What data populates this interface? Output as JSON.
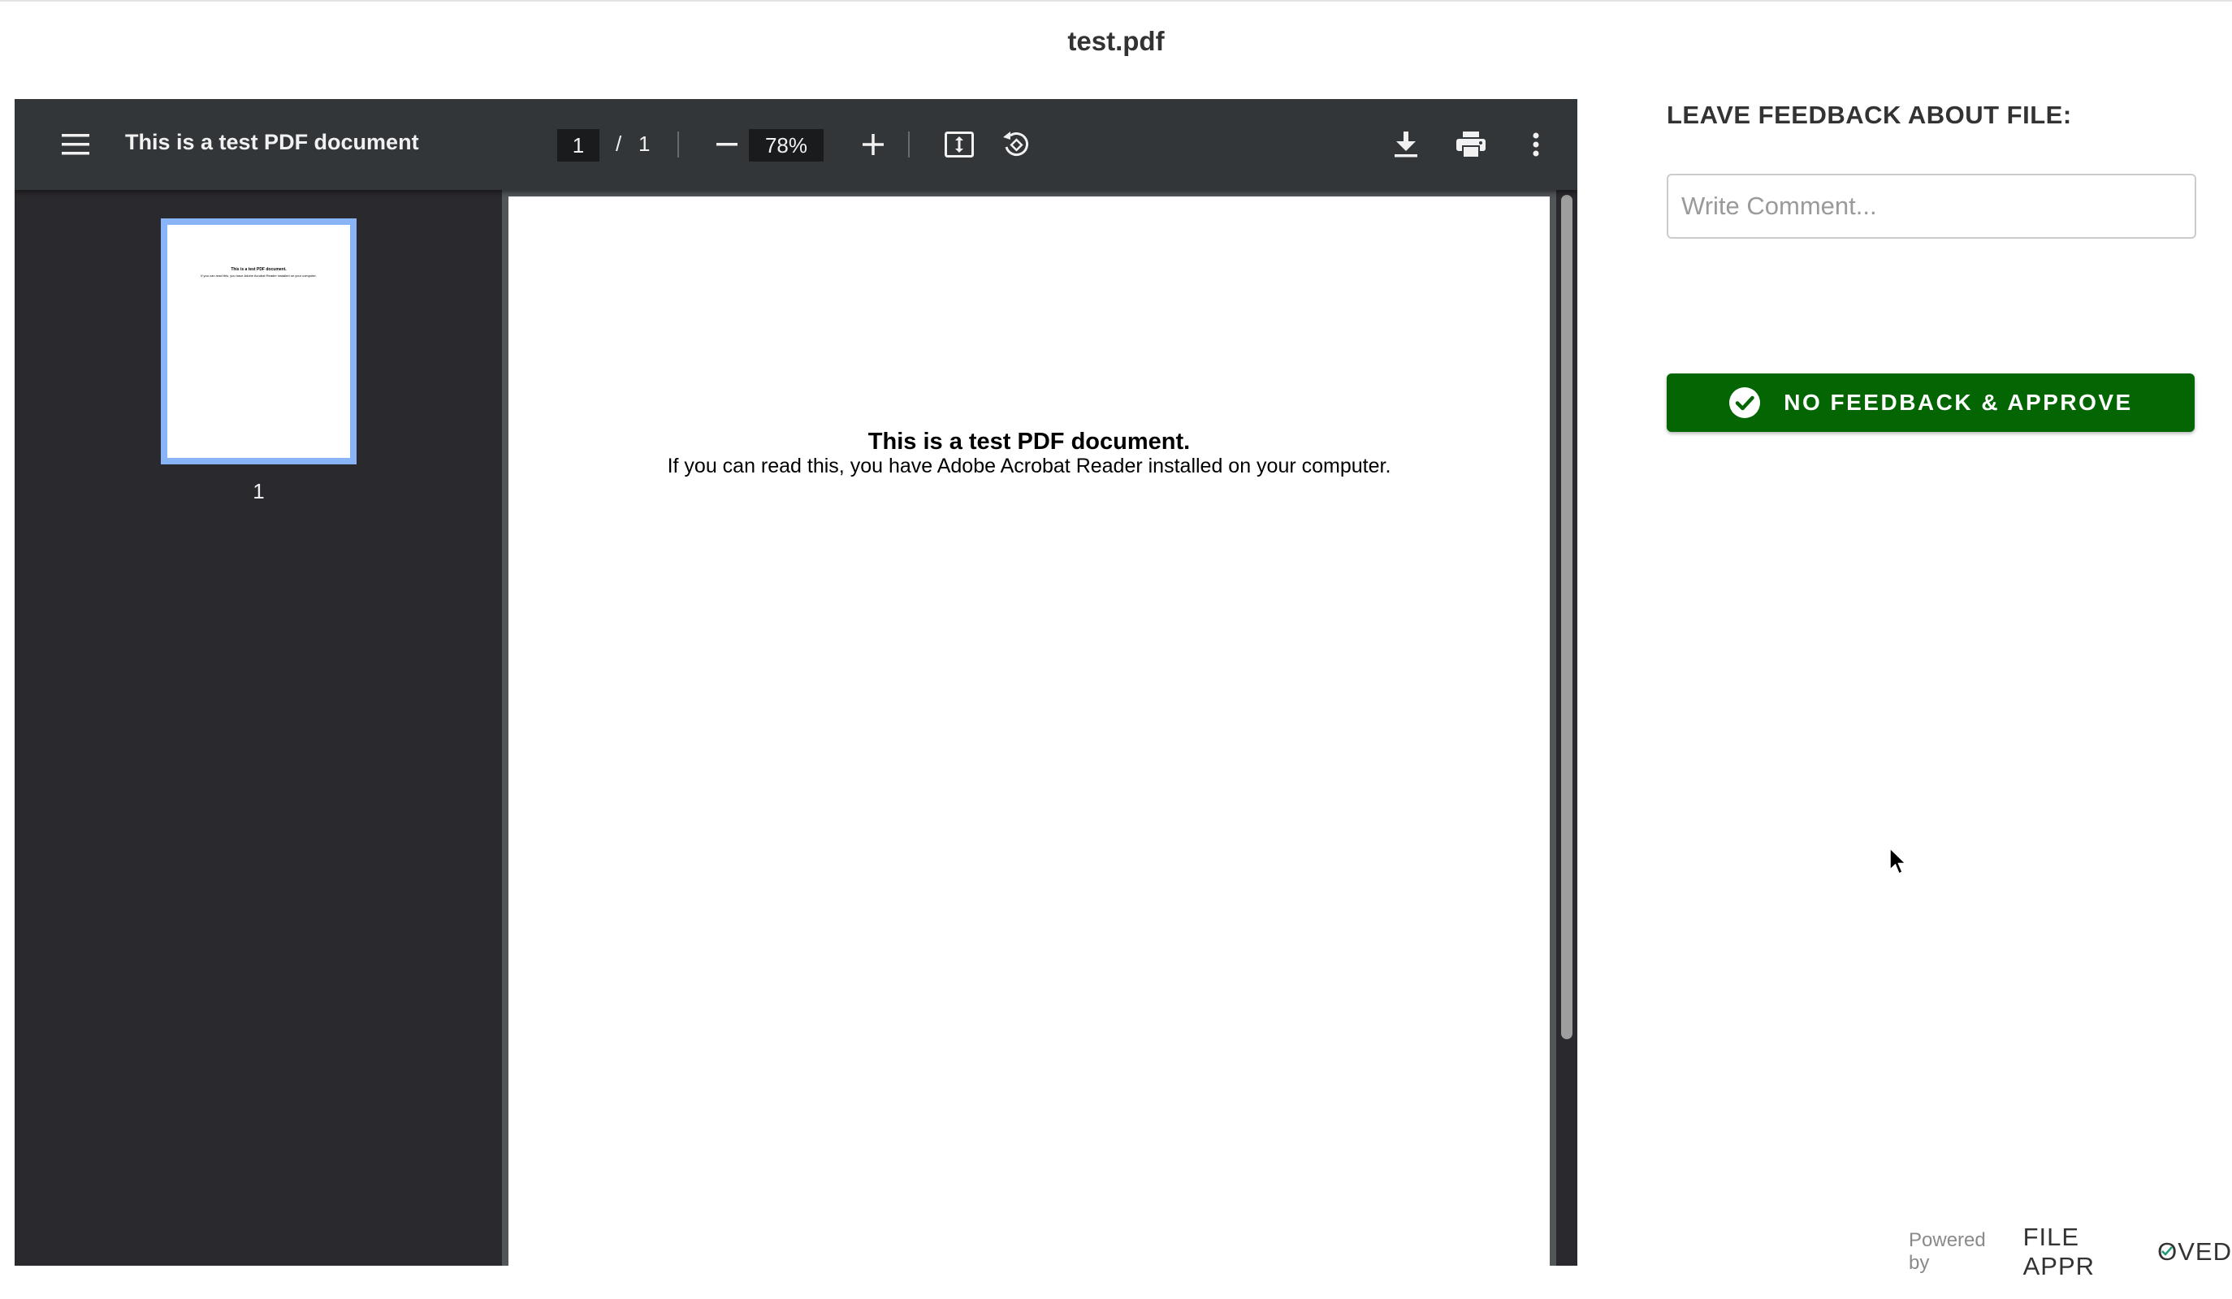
{
  "header": {
    "title": "test.pdf"
  },
  "viewer": {
    "toolbar": {
      "menu_icon": "hamburger-menu-icon",
      "doc_title": "This is a test PDF document",
      "current_page": "1",
      "page_separator": "/",
      "total_pages": "1",
      "zoom": "78%",
      "icons": [
        "minus-icon",
        "plus-icon",
        "fit-page-icon",
        "rotate-icon",
        "download-icon",
        "print-icon",
        "more-vertical-icon"
      ]
    },
    "thumbnails": [
      {
        "number": "1",
        "heading": "This is a test PDF document.",
        "body": "If you can read this, you have Adobe Acrobat Reader installed on your computer."
      }
    ],
    "page": {
      "heading": "This is a test PDF document.",
      "body": "If you can read this, you have Adobe Acrobat Reader installed on your computer."
    }
  },
  "feedback": {
    "heading": "LEAVE FEEDBACK ABOUT FILE:",
    "comment_placeholder": "Write Comment...",
    "comment_value": "",
    "approve_label": "NO FEEDBACK & APPROVE",
    "approve_color": "#036603",
    "approve_icon": "check-circle-icon"
  },
  "footer": {
    "powered_by": "Powered by",
    "brand_pre": "FILE APPR",
    "brand_o": "O",
    "brand_post": "VED",
    "brand_check_color": "#1a9a7a"
  }
}
